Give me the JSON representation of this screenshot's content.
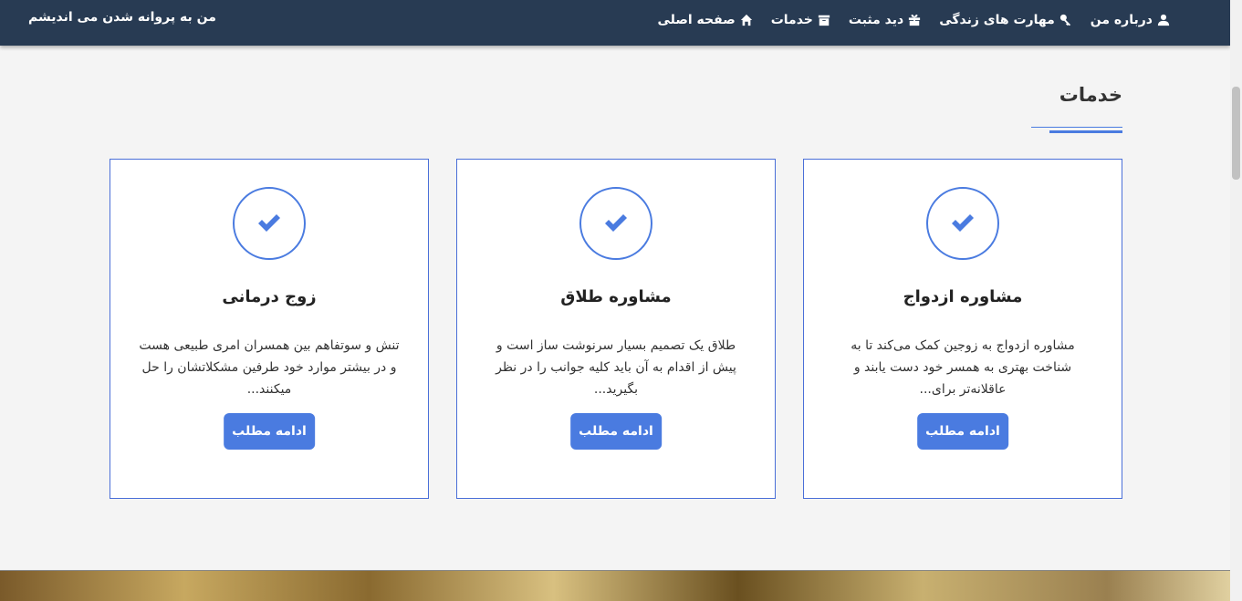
{
  "nav": {
    "brand": "من به پروانه شدن می اندیشم",
    "items": [
      {
        "label": "صفحه اصلی",
        "icon": "home-icon"
      },
      {
        "label": "خدمات",
        "icon": "archive-icon"
      },
      {
        "label": "دید مثبت",
        "icon": "gift-icon"
      },
      {
        "label": "مهارت های زندگی",
        "icon": "key-icon"
      },
      {
        "label": "درباره من",
        "icon": "user-icon"
      }
    ]
  },
  "section": {
    "title": "خدمات"
  },
  "cards": [
    {
      "title": "مشاوره ازدواج",
      "text": "مشاوره ازدواج به زوجین کمک می‌کند تا به شناخت بهتری به همسر خود دست یابند و عاقلانه‌تر برای...",
      "button": "ادامه مطلب",
      "icon": "check-icon"
    },
    {
      "title": "مشاوره طلاق",
      "text": "طلاق یک تصمیم بسیار سرنوشت ساز است و پیش از اقدام به آن باید کلیه جوانب را در نظر بگیرید...",
      "button": "ادامه مطلب",
      "icon": "check-icon"
    },
    {
      "title": "زوج درمانی",
      "text": "تنش و سوتفاهم بین همسران امری طبیعی هست و در بیشتر موارد خود طرفین مشکلاتشان را حل میکنند...",
      "button": "ادامه مطلب",
      "icon": "check-icon"
    }
  ],
  "colors": {
    "navbar": "#283b53",
    "accent": "#4a7be0",
    "background": "#f4f4f4"
  }
}
